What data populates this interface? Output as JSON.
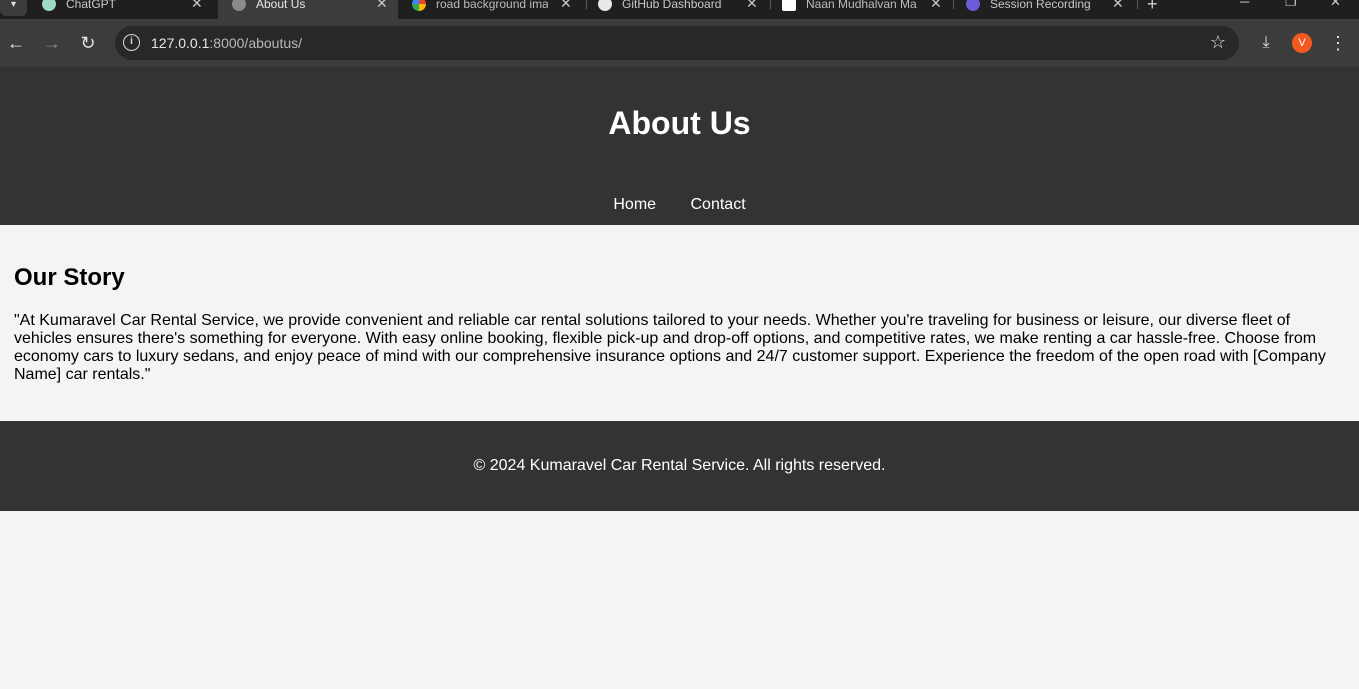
{
  "browser": {
    "tabs": [
      {
        "title": "ChatGPT",
        "active": false
      },
      {
        "title": "About Us",
        "active": true
      },
      {
        "title": "road background ima",
        "active": false
      },
      {
        "title": "GitHub Dashboard",
        "active": false
      },
      {
        "title": "Naan Mudhalvan Ma",
        "active": false
      },
      {
        "title": "Session Recording",
        "active": false
      }
    ],
    "url_host": "127.0.0.1",
    "url_path": ":8000/aboutus/",
    "profile_initial": "V"
  },
  "site": {
    "title": "About Us",
    "nav": [
      {
        "label": "Home"
      },
      {
        "label": "Contact"
      }
    ],
    "section_heading": "Our Story",
    "story": "\"At Kumaravel Car Rental Service, we provide convenient and reliable car rental solutions tailored to your needs. Whether you're traveling for business or leisure, our diverse fleet of vehicles ensures there's something for everyone. With easy online booking, flexible pick-up and drop-off options, and competitive rates, we make renting a car hassle-free. Choose from economy cars to luxury sedans, and enjoy peace of mind with our comprehensive insurance options and 24/7 customer support. Experience the freedom of the open road with [Company Name] car rentals.\"",
    "footer": "© 2024 Kumaravel Car Rental Service. All rights reserved."
  },
  "colors": {
    "header_bg": "#333333",
    "page_bg": "#f4f4f4",
    "profile": "#f25a22"
  }
}
